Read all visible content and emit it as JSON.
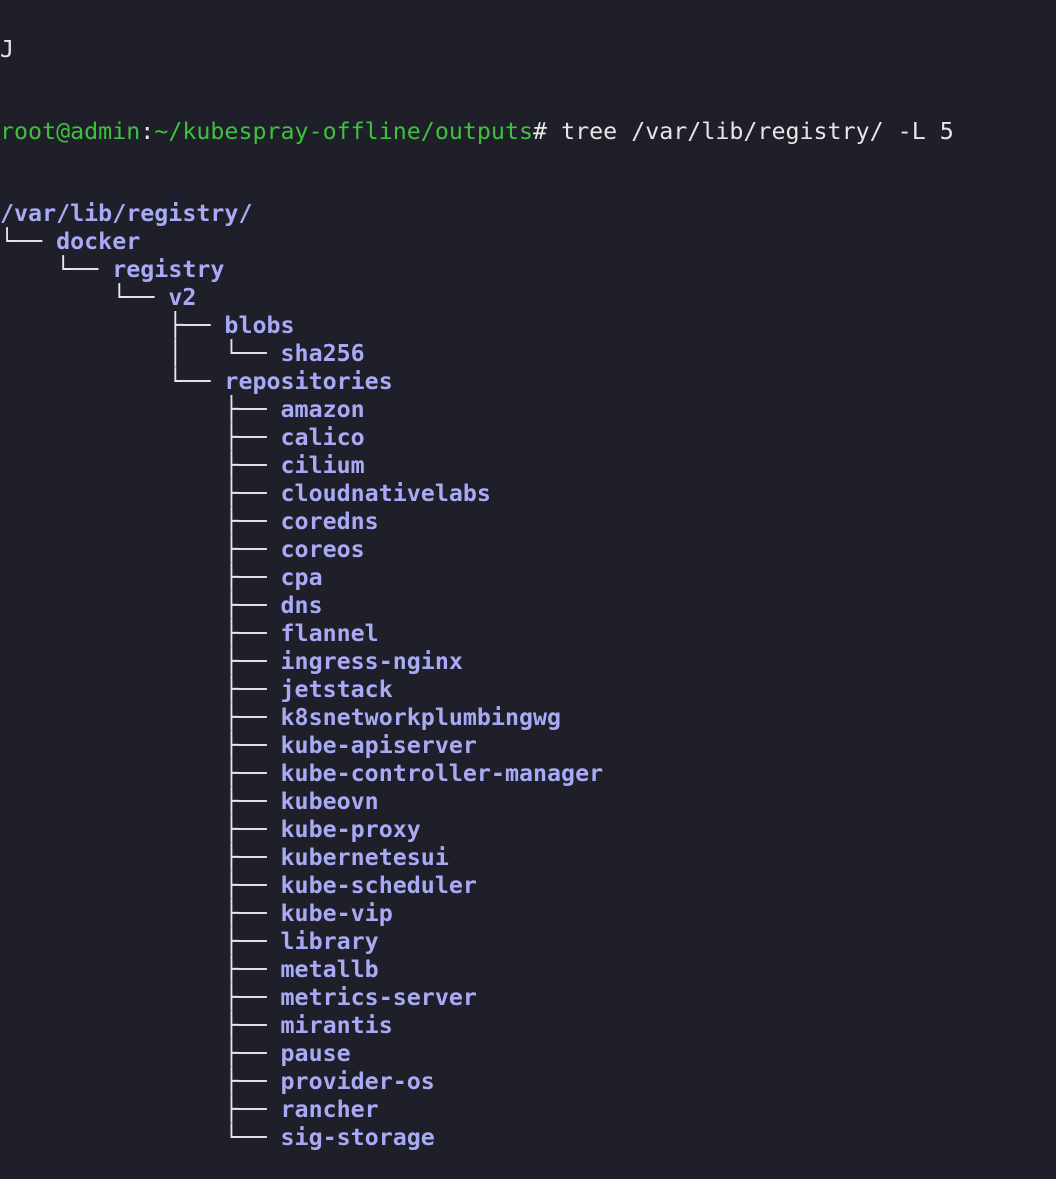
{
  "terminal": {
    "previous_line_fragment": "J",
    "prompt": {
      "user_host": "root@admin",
      "colon": ":",
      "path": "~/kubespray-offline/outputs",
      "sign": "# "
    },
    "command": "tree /var/lib/registry/ -L 5",
    "tree": [
      {
        "prefix": "",
        "name": "/var/lib/registry/"
      },
      {
        "prefix": "└── ",
        "name": "docker"
      },
      {
        "prefix": "    └── ",
        "name": "registry"
      },
      {
        "prefix": "        └── ",
        "name": "v2"
      },
      {
        "prefix": "            ├── ",
        "name": "blobs"
      },
      {
        "prefix": "            │   └── ",
        "name": "sha256"
      },
      {
        "prefix": "            └── ",
        "name": "repositories"
      },
      {
        "prefix": "                ├── ",
        "name": "amazon"
      },
      {
        "prefix": "                ├── ",
        "name": "calico"
      },
      {
        "prefix": "                ├── ",
        "name": "cilium"
      },
      {
        "prefix": "                ├── ",
        "name": "cloudnativelabs"
      },
      {
        "prefix": "                ├── ",
        "name": "coredns"
      },
      {
        "prefix": "                ├── ",
        "name": "coreos"
      },
      {
        "prefix": "                ├── ",
        "name": "cpa"
      },
      {
        "prefix": "                ├── ",
        "name": "dns"
      },
      {
        "prefix": "                ├── ",
        "name": "flannel"
      },
      {
        "prefix": "                ├── ",
        "name": "ingress-nginx"
      },
      {
        "prefix": "                ├── ",
        "name": "jetstack"
      },
      {
        "prefix": "                ├── ",
        "name": "k8snetworkplumbingwg"
      },
      {
        "prefix": "                ├── ",
        "name": "kube-apiserver"
      },
      {
        "prefix": "                ├── ",
        "name": "kube-controller-manager"
      },
      {
        "prefix": "                ├── ",
        "name": "kubeovn"
      },
      {
        "prefix": "                ├── ",
        "name": "kube-proxy"
      },
      {
        "prefix": "                ├── ",
        "name": "kubernetesui"
      },
      {
        "prefix": "                ├── ",
        "name": "kube-scheduler"
      },
      {
        "prefix": "                ├── ",
        "name": "kube-vip"
      },
      {
        "prefix": "                ├── ",
        "name": "library"
      },
      {
        "prefix": "                ├── ",
        "name": "metallb"
      },
      {
        "prefix": "                ├── ",
        "name": "metrics-server"
      },
      {
        "prefix": "                ├── ",
        "name": "mirantis"
      },
      {
        "prefix": "                ├── ",
        "name": "pause"
      },
      {
        "prefix": "                ├── ",
        "name": "provider-os"
      },
      {
        "prefix": "                ├── ",
        "name": "rancher"
      },
      {
        "prefix": "                └── ",
        "name": "sig-storage"
      }
    ]
  },
  "colors": {
    "background": "#1e1f29",
    "prompt_green": "#3fc03f",
    "directory_blue": "#a8aaf5",
    "text": "#e6e6e6"
  }
}
